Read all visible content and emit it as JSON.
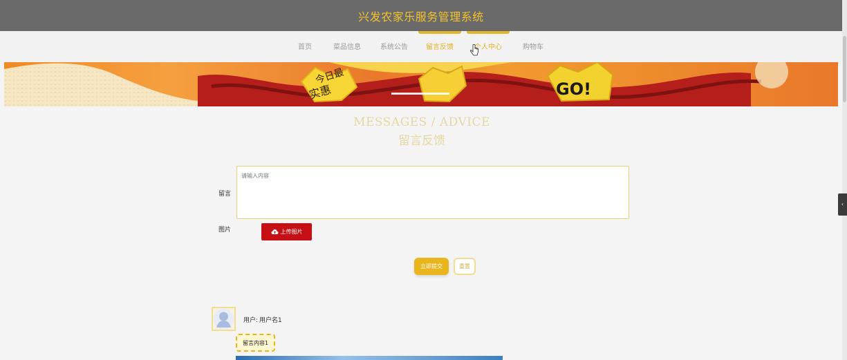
{
  "header": {
    "title": "兴发农家乐服务管理系统"
  },
  "nav": {
    "items": [
      {
        "label": "首页"
      },
      {
        "label": "菜品信息"
      },
      {
        "label": "系统公告"
      },
      {
        "label": "留言反馈",
        "active": true
      },
      {
        "label": "个人中心"
      },
      {
        "label": "购物车"
      }
    ]
  },
  "banner": {
    "texts": [
      "今日最",
      "实惠",
      "GO!"
    ]
  },
  "section": {
    "title_en": "MESSAGES / ADVICE",
    "title_zh": "留言反馈"
  },
  "form": {
    "message_label": "留言",
    "message_placeholder": "请输入内容",
    "image_label": "图片",
    "upload_label": "上传图片",
    "submit_label": "立即提交",
    "reset_label": "重置"
  },
  "comments": [
    {
      "user_prefix": "用户:",
      "user_name": "用户名1",
      "content": "留言内容1"
    }
  ],
  "colors": {
    "accent": "#e8b51c",
    "header_bg": "#6a6a6a",
    "upload_bg": "#c50f14"
  }
}
